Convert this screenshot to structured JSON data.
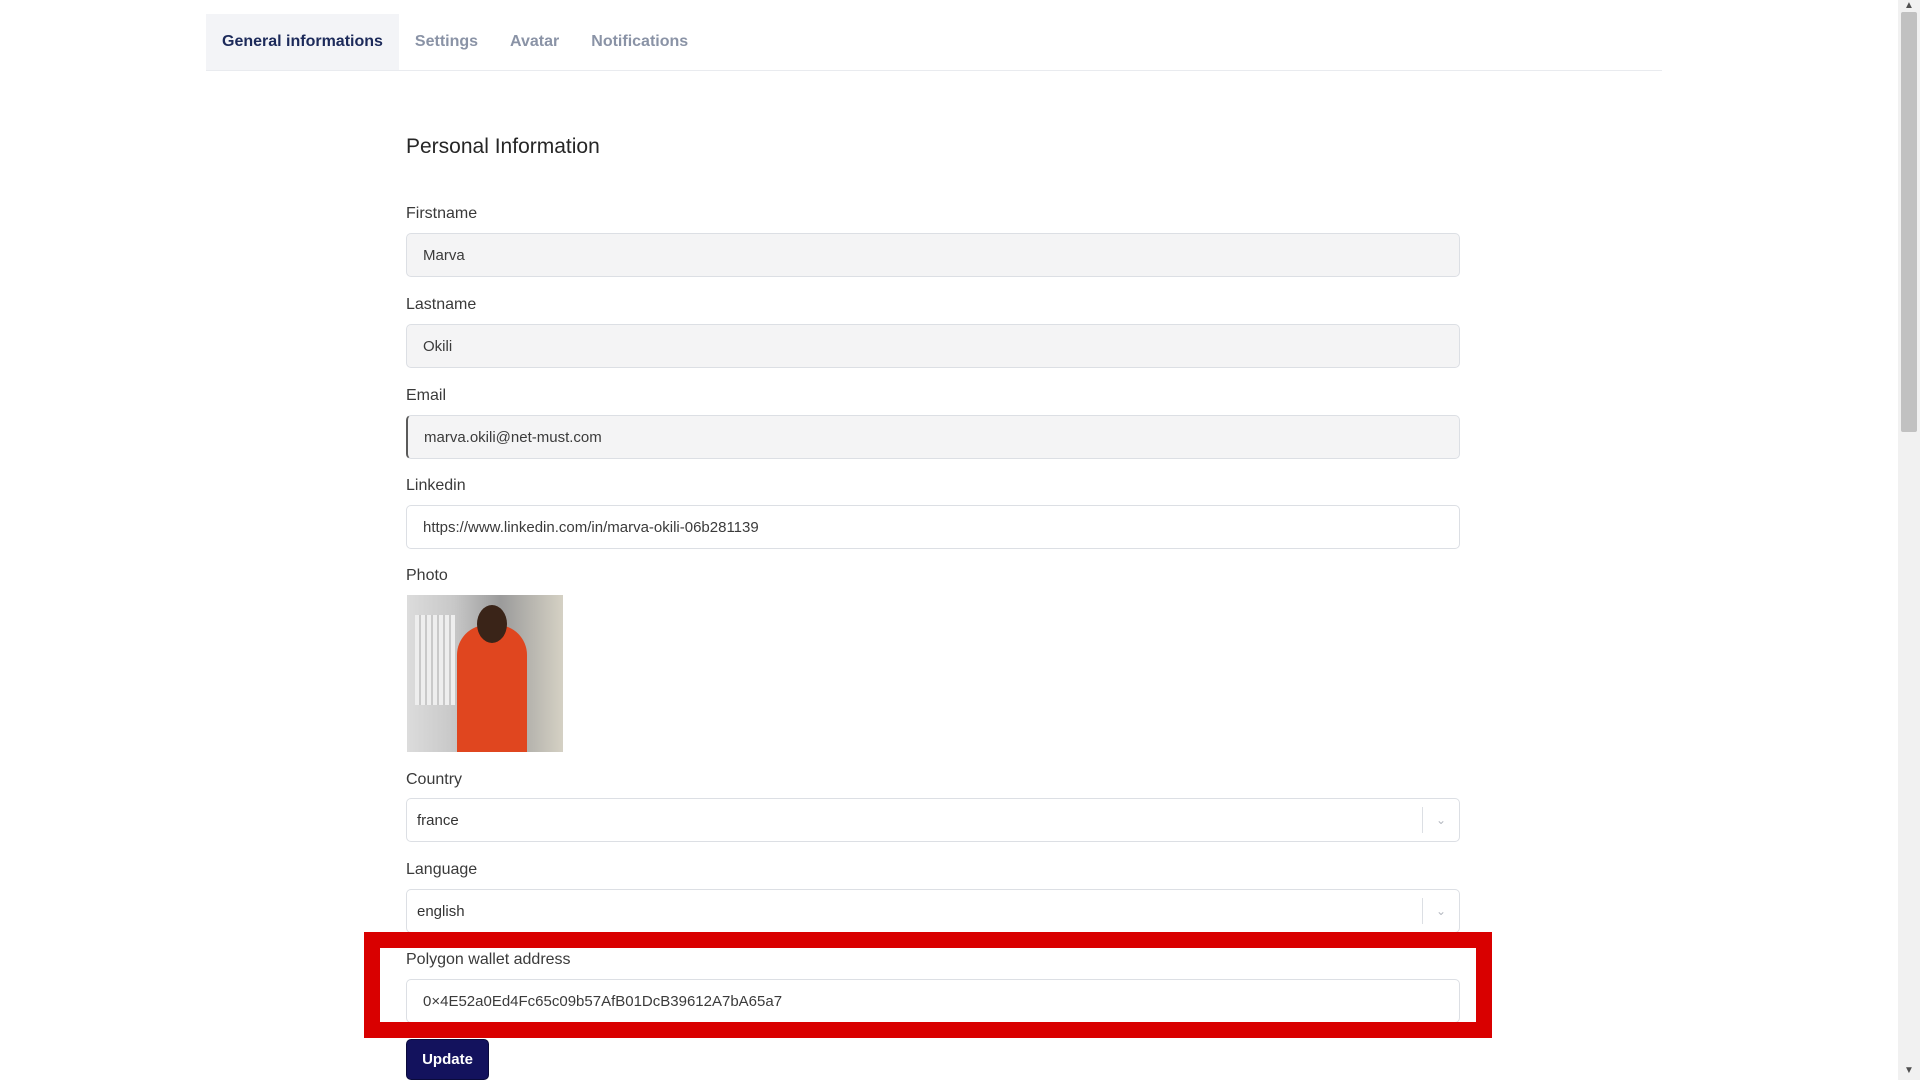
{
  "tabs": [
    {
      "label": "General informations",
      "active": true
    },
    {
      "label": "Settings",
      "active": false
    },
    {
      "label": "Avatar",
      "active": false
    },
    {
      "label": "Notifications",
      "active": false
    }
  ],
  "section_title": "Personal Information",
  "fields": {
    "firstname": {
      "label": "Firstname",
      "value": "Marva"
    },
    "lastname": {
      "label": "Lastname",
      "value": "Okili"
    },
    "email": {
      "label": "Email",
      "value": "marva.okili@net-must.com"
    },
    "linkedin": {
      "label": "Linkedin",
      "value": "https://www.linkedin.com/in/marva-okili-06b281139"
    },
    "photo": {
      "label": "Photo"
    },
    "country": {
      "label": "Country",
      "value": "france"
    },
    "language": {
      "label": "Language",
      "value": "english"
    },
    "wallet": {
      "label": "Polygon wallet address",
      "value": "0×4E52a0Ed4Fc65c09b57AfB01DcB39612A7bA65a7"
    }
  },
  "update_button": "Update",
  "colors": {
    "highlight": "#d90000",
    "button": "#13125d",
    "active_tab_text": "#1c2a5a",
    "inactive_tab_text": "#8a93a6"
  },
  "icons": [
    "chevron-down-icon"
  ]
}
